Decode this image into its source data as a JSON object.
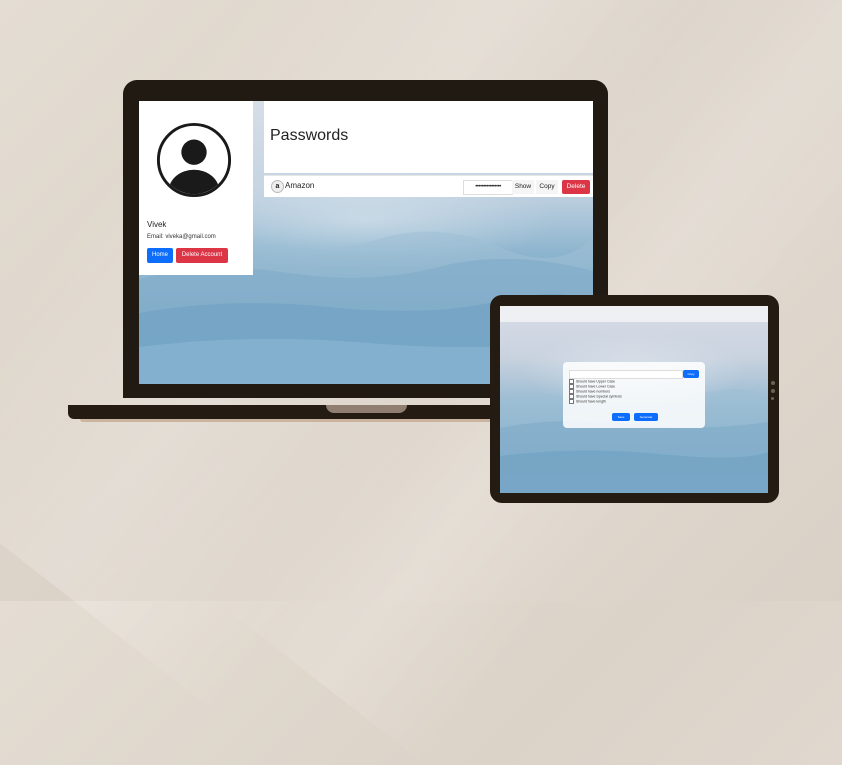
{
  "laptop": {
    "profile": {
      "name": "Vivek",
      "email": "Email: viveka@gmail.com",
      "home_button": "Home",
      "delete_account_button": "Delete Account"
    },
    "passwords": {
      "title": "Passwords",
      "entries": [
        {
          "icon": "a",
          "site": "Amazon",
          "masked_password": "••••••••••••••••",
          "show_label": "Show",
          "copy_label": "Copy",
          "delete_label": "Delete"
        }
      ]
    }
  },
  "tablet": {
    "generator": {
      "copy_label": "Copy",
      "options": [
        "Should have Upper Case",
        "Should have Lower Case",
        "Should have numbers",
        "Should have Special symbols",
        "Should have length"
      ],
      "save_label": "Save",
      "generate_label": "Generate"
    }
  },
  "colors": {
    "primary": "#0d6efd",
    "danger": "#dc3545",
    "device_frame": "#211a12",
    "background": "#ddd5cb"
  }
}
